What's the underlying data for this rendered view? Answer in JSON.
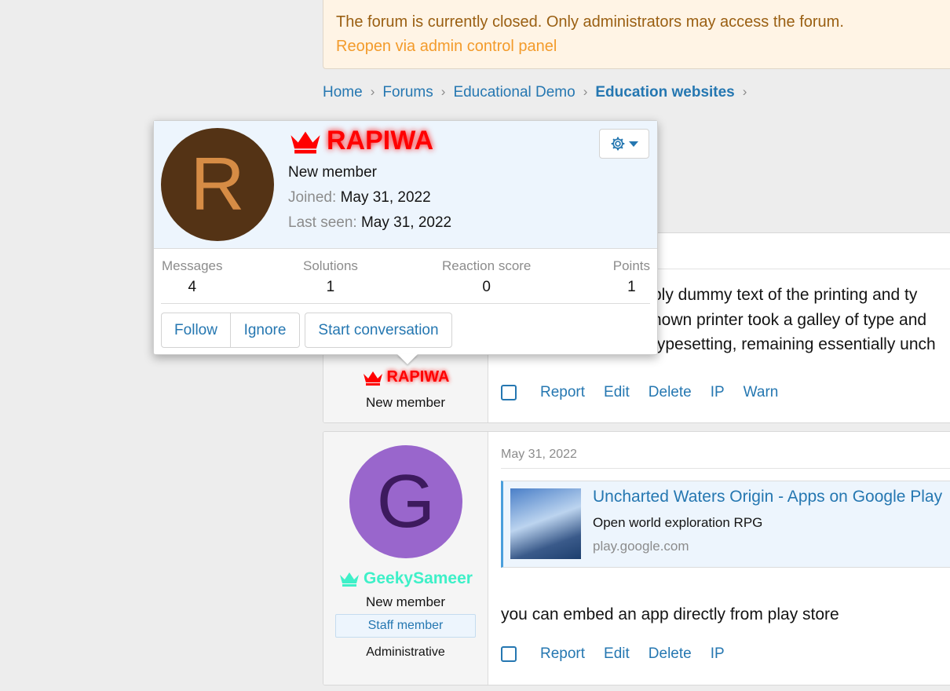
{
  "notice": {
    "message": "The forum is currently closed. Only administrators may access the forum.",
    "link": "Reopen via admin control panel"
  },
  "breadcrumb": [
    "Home",
    "Forums",
    "Educational Demo",
    "Education websites"
  ],
  "popup": {
    "avatar_letter": "R",
    "username": "RAPIWA",
    "title": "New member",
    "joined_label": "Joined:",
    "joined": "May 31, 2022",
    "last_seen_label": "Last seen:",
    "last_seen": "May 31, 2022",
    "stats": [
      {
        "label": "Messages",
        "value": "4"
      },
      {
        "label": "Solutions",
        "value": "1"
      },
      {
        "label": "Reaction score",
        "value": "0"
      },
      {
        "label": "Points",
        "value": "1"
      }
    ],
    "buttons": {
      "follow": "Follow",
      "ignore": "Ignore",
      "start": "Start conversation"
    }
  },
  "post1": {
    "username": "RAPIWA",
    "title": "New member",
    "lines": [
      "ply dummy text of the printing and ty",
      "nown printer took a galley of type and",
      "typesetting, remaining essentially unch"
    ],
    "actions": [
      "Report",
      "Edit",
      "Delete",
      "IP",
      "Warn"
    ]
  },
  "post2": {
    "avatar_letter": "G",
    "username": "GeekySameer",
    "title": "New member",
    "banner": "Staff member",
    "group": "Administrative",
    "date": "May 31, 2022",
    "embed": {
      "title": "Uncharted Waters Origin - Apps on Google Play",
      "description": "Open world exploration RPG",
      "domain": "play.google.com"
    },
    "text": "you can embed an app directly from play store",
    "actions": [
      "Report",
      "Edit",
      "Delete",
      "IP"
    ]
  },
  "colors": {
    "link": "#2577b1",
    "rapiwa": "#ff0000",
    "geeky": "#3ef0c8",
    "avatar_r": "#543315",
    "avatar_g": "#9966cc"
  }
}
